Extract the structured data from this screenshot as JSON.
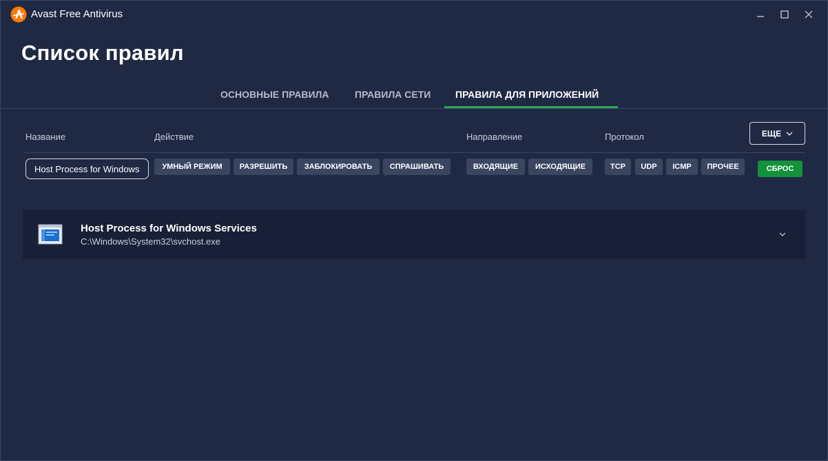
{
  "app": {
    "title": "Avast Free Antivirus",
    "logo_icon": "avast-logo-icon",
    "accent": "#ff7800"
  },
  "window_controls": {
    "minimize_icon": "minimize-icon",
    "maximize_icon": "maximize-icon",
    "close_icon": "close-icon"
  },
  "page": {
    "title": "Список правил"
  },
  "tabs": [
    {
      "label": "ОСНОВНЫЕ ПРАВИЛА",
      "active": false
    },
    {
      "label": "ПРАВИЛА СЕТИ",
      "active": false
    },
    {
      "label": "ПРАВИЛА ДЛЯ ПРИЛОЖЕНИЙ",
      "active": true
    }
  ],
  "filters": {
    "name_label": "Название",
    "action_label": "Действие",
    "direction_label": "Направление",
    "protocol_label": "Протокол",
    "more_label": "ЕЩЕ",
    "search_value": "Host Process for Windows Services",
    "actions": [
      "УМНЫЙ РЕЖИМ",
      "РАЗРЕШИТЬ",
      "ЗАБЛОКИРОВАТЬ",
      "СПРАШИВАТЬ"
    ],
    "directions": [
      "ВХОДЯЩИЕ",
      "ИСХОДЯЩИЕ"
    ],
    "protocols": [
      "TCP",
      "UDP",
      "ICMP",
      "ПРОЧЕЕ"
    ],
    "reset_label": "СБРОС"
  },
  "rules": [
    {
      "name": "Host Process for Windows Services",
      "path": "C:\\Windows\\System32\\svchost.exe",
      "icon": "app-window-icon"
    }
  ],
  "colors": {
    "background": "#1f2944",
    "row_background": "#182037",
    "chip": "#3a4560",
    "reset": "#14923b",
    "tab_underline": "#2fa84f"
  }
}
